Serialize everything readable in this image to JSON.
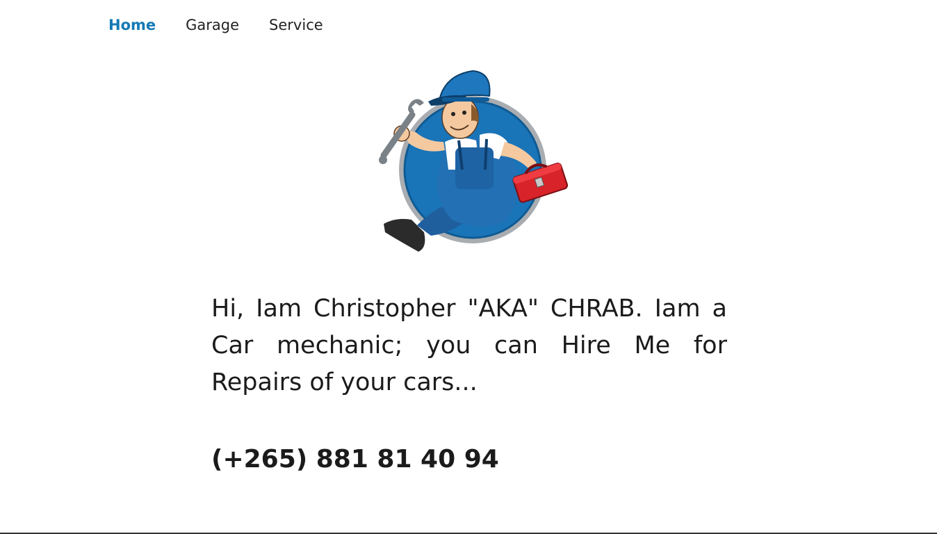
{
  "nav": {
    "items": [
      {
        "label": "Home",
        "active": true
      },
      {
        "label": "Garage",
        "active": false
      },
      {
        "label": "Service",
        "active": false
      }
    ],
    "accent_color": "#1579b5"
  },
  "hero": {
    "logo_icon": "mechanic-mascot-icon",
    "intro_text": "Hi, Iam Christopher \"AKA\" CHRAB. Iam a Car mechanic; you can Hire Me for Repairs of your cars...",
    "phone": "(+265) 881 81 40 94"
  }
}
